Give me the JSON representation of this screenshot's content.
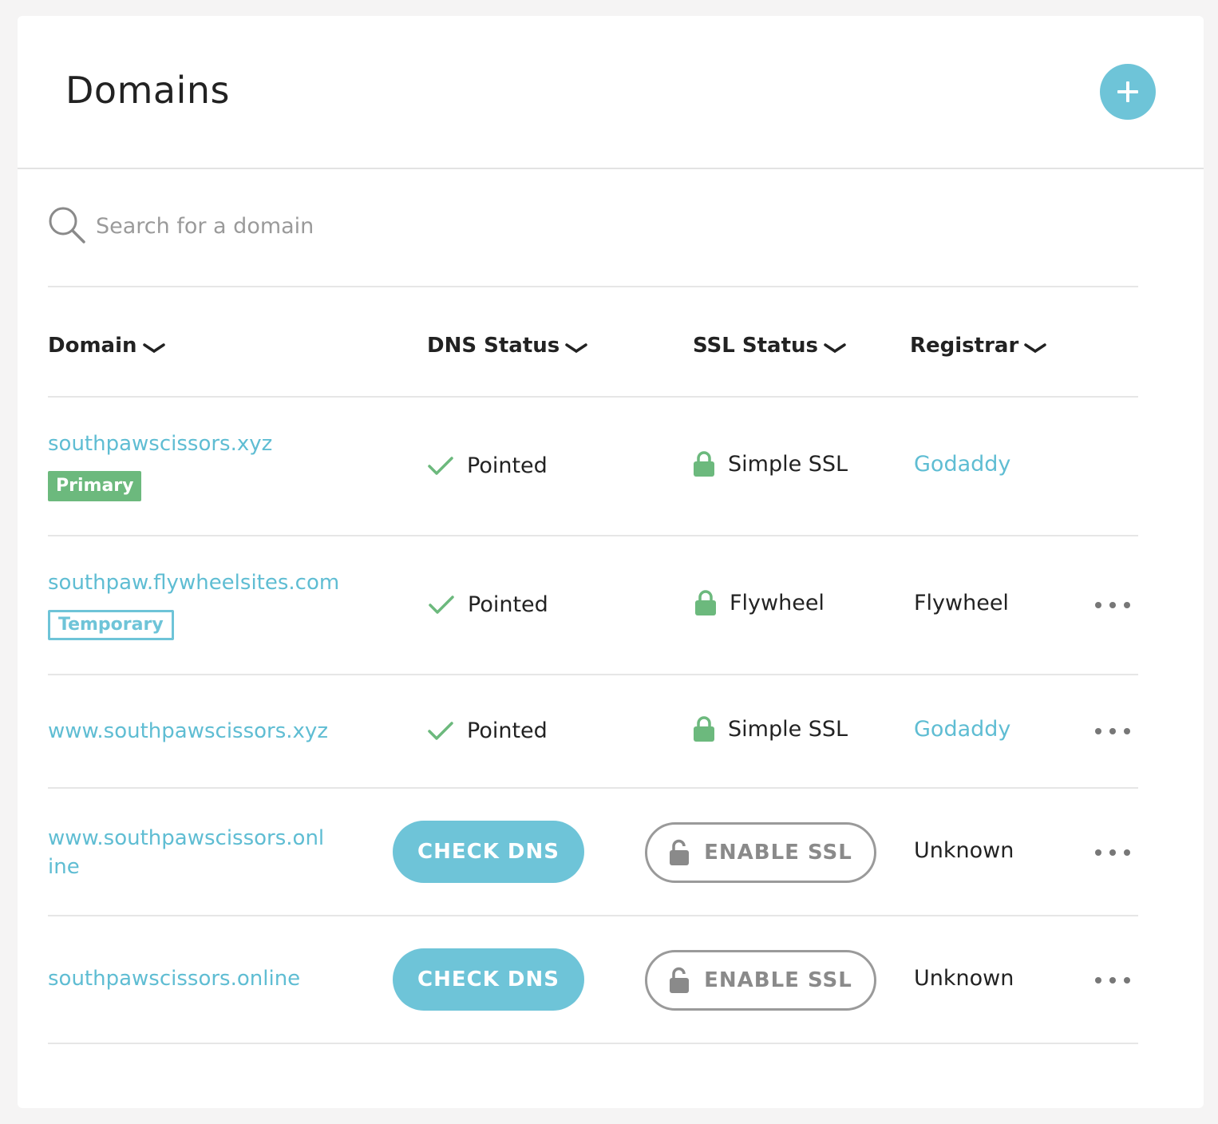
{
  "header": {
    "title": "Domains",
    "add_icon": "plus-icon"
  },
  "search": {
    "placeholder": "Search for a domain",
    "value": ""
  },
  "columns": {
    "domain": "Domain",
    "dns": "DNS Status",
    "ssl": "SSL Status",
    "registrar": "Registrar"
  },
  "rows": [
    {
      "domain": "southpawscissors.xyz",
      "badge": "Primary",
      "dns": "Pointed",
      "ssl": "Simple SSL",
      "registrar": "Godaddy"
    },
    {
      "domain": "southpaw.flywheelsites.com",
      "badge": "Temporary",
      "dns": "Pointed",
      "ssl": "Flywheel",
      "registrar": "Flywheel"
    },
    {
      "domain": "www.southpawscissors.xyz",
      "dns": "Pointed",
      "ssl": "Simple SSL",
      "registrar": "Godaddy"
    },
    {
      "domain": "www.southpawscissors.online",
      "dns_action": "CHECK DNS",
      "ssl_action": "ENABLE SSL",
      "registrar": "Unknown"
    },
    {
      "domain": "southpawscissors.online",
      "dns_action": "CHECK DNS",
      "ssl_action": "ENABLE SSL",
      "registrar": "Unknown"
    }
  ],
  "colors": {
    "accent": "#6ec4d8",
    "link": "#5fbdd3",
    "success": "#6cb97d",
    "muted": "#9a9a9a"
  }
}
